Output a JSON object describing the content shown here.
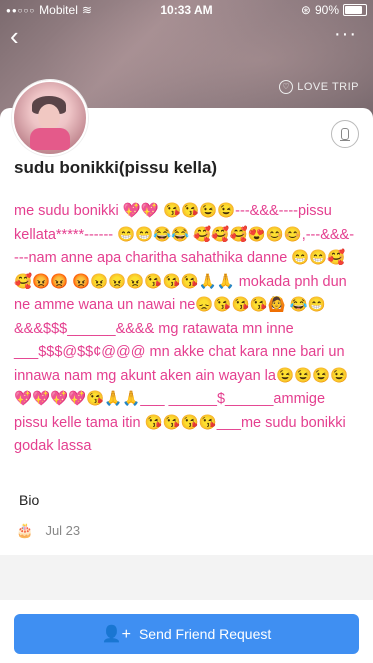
{
  "status": {
    "carrier": "Mobitel",
    "time": "10:33 AM",
    "battery": "90%"
  },
  "nav": {
    "back_icon": "chevron-left",
    "more_icon": "ellipsis"
  },
  "hero": {
    "love_trip": "LOVE TRIP"
  },
  "profile": {
    "name": "sudu bonikki(pissu kella)",
    "about": "me sudu bonikki 💖💖 😘😘😉😉---&&&----pissu kellata*****------ 😁😁😂😂 🥰🥰🥰😍😊😊,---&&&----nam anne apa charitha sahathika danne 😁😁🥰🥰😡😡 😡😠😠😠😘😘😘🙏🙏 mokada pnh dun ne amme wana un nawai ne😞😘😘😘🙆 😂😁&&&$$$______&&&& mg ratawata mn inne ___$$$@$$¢@@@ mn akke chat kara nne bari un innawa nam mg akunt aken ain wayan la😉😉😉😉💖💖💖💖😘🙏🙏___ ______$______ammige pissu kelle tama itin 😘😘😘😘___me sudu bonikki godak lassa"
  },
  "bio": {
    "label": "Bio",
    "date": "Jul 23"
  },
  "footer": {
    "send_label": "Send Friend Request"
  }
}
